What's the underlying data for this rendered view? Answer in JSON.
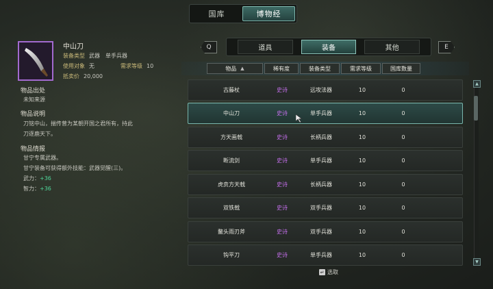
{
  "top_tabs": [
    "国库",
    "博物经"
  ],
  "item": {
    "name": "中山刀",
    "type_label": "装备类型",
    "type_value": "武器　单手兵器",
    "target_label": "使用对象",
    "target_value": "无",
    "req_label": "需求等级",
    "req_value": "10",
    "price_label": "抵卖价",
    "price_value": "20,000",
    "origin_title": "物品出处",
    "origin_text": "未知来源",
    "desc_title": "物品说明",
    "desc_line1": "刀铭中山，揣传曾为某朝开国之君所有，持此",
    "desc_line2": "刀逐鹿天下。",
    "info_title": "物品情报",
    "info_line1": "甘宁专属武器。",
    "info_line2": "甘宁装备可获得额外技能：武器觉醒(三)。",
    "stat1_label": "武力：",
    "stat1_value": "+36",
    "stat2_label": "智力：",
    "stat2_value": "+36"
  },
  "key_prev": "Q",
  "key_next": "E",
  "category_tabs": [
    "道具",
    "装备",
    "其他"
  ],
  "columns": [
    "物品",
    "稀有度",
    "装备类型",
    "需求等级",
    "国库数量"
  ],
  "sort_icon": "▲",
  "rows": [
    {
      "name": "古藤杖",
      "rarity": "史诗",
      "type": "远攻法器",
      "level": "10",
      "qty": "0"
    },
    {
      "name": "中山刀",
      "rarity": "史诗",
      "type": "单手兵器",
      "level": "10",
      "qty": "0"
    },
    {
      "name": "方天画戟",
      "rarity": "史诗",
      "type": "长柄兵器",
      "level": "10",
      "qty": "0"
    },
    {
      "name": "断流剑",
      "rarity": "史诗",
      "type": "单手兵器",
      "level": "10",
      "qty": "0"
    },
    {
      "name": "虎贲方天戟",
      "rarity": "史诗",
      "type": "长柄兵器",
      "level": "10",
      "qty": "0"
    },
    {
      "name": "双铁戟",
      "rarity": "史诗",
      "type": "双手兵器",
      "level": "10",
      "qty": "0"
    },
    {
      "name": "鳌头雨刃斧",
      "rarity": "史诗",
      "type": "双手兵器",
      "level": "10",
      "qty": "0"
    },
    {
      "name": "钩平刀",
      "rarity": "史诗",
      "type": "单手兵器",
      "level": "10",
      "qty": "0"
    }
  ],
  "selected_row": 1,
  "select_hint": "选取",
  "select_key": "↵",
  "colors": {
    "rarity_epic": "#c06de6",
    "accent": "#79b7ad",
    "stat": "#4fd69a"
  }
}
